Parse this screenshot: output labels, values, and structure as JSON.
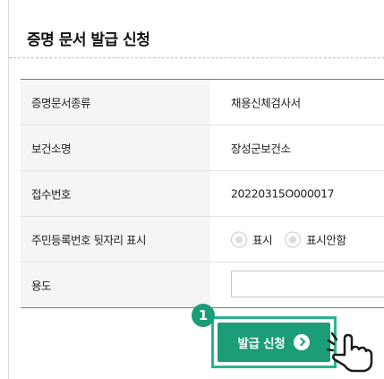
{
  "form": {
    "title": "증명 문서 발급 신청",
    "rows": [
      {
        "label": "증명문서종류",
        "value": "채용신체검사서"
      },
      {
        "label": "보건소명",
        "value": "장성군보건소"
      },
      {
        "label": "접수번호",
        "value": "20220315O000017"
      },
      {
        "label": "주민등록번호 뒷자리 표시",
        "options": [
          "표시",
          "표시안함"
        ]
      },
      {
        "label": "용도",
        "value": ""
      }
    ]
  },
  "step_badge": "1",
  "submit_label": "발급 신청",
  "icons": {
    "submit": "arrow-right-circle-icon",
    "pointer": "hand-pointer-icon"
  },
  "colors": {
    "accent": "#1b9d77",
    "highlight": "#2bb48e"
  }
}
